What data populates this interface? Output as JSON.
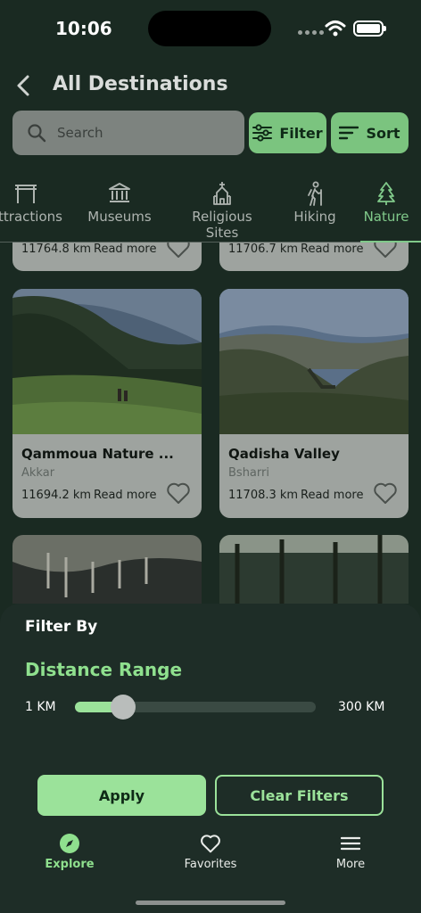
{
  "status": {
    "time": "10:06"
  },
  "header": {
    "title": "All Destinations"
  },
  "search": {
    "placeholder": "Search"
  },
  "buttons": {
    "filter": "Filter",
    "sort": "Sort"
  },
  "categories": [
    {
      "label": "Attractions",
      "icon": "gate-icon"
    },
    {
      "label": "Museums",
      "icon": "museum-icon"
    },
    {
      "label": "Religious Sites",
      "icon": "church-icon"
    },
    {
      "label": "Hiking",
      "icon": "hiker-icon"
    },
    {
      "label": "Nature",
      "icon": "tree-icon",
      "active": true
    }
  ],
  "top_cards": [
    {
      "distance": "11764.8 km",
      "more": "Read more"
    },
    {
      "distance": "11706.7 km",
      "more": "Read more"
    }
  ],
  "cards": [
    {
      "name": "Qammoua Nature ...",
      "location": "Akkar",
      "distance": "11694.2 km",
      "more": "Read more"
    },
    {
      "name": "Qadisha Valley",
      "location": "Bsharri",
      "distance": "11708.3 km",
      "more": "Read more"
    }
  ],
  "filter_sheet": {
    "title": "Filter By",
    "section": "Distance Range",
    "min_label": "1 KM",
    "max_label": "300 KM",
    "slider_fraction": 0.2,
    "apply": "Apply",
    "clear": "Clear Filters"
  },
  "tabbar": [
    {
      "label": "Explore",
      "icon": "compass-icon",
      "active": true
    },
    {
      "label": "Favorites",
      "icon": "heart-icon"
    },
    {
      "label": "More",
      "icon": "menu-icon"
    }
  ],
  "colors": {
    "accent": "#8fe08e",
    "sheet": "#1e2d27"
  }
}
